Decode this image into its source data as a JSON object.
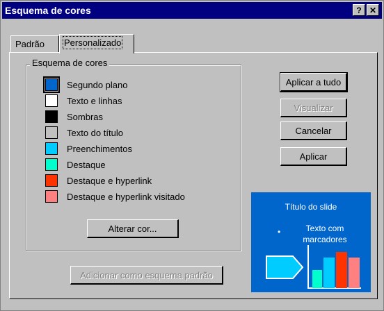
{
  "window": {
    "title": "Esquema de cores",
    "help_button": "?",
    "close_button": "✕"
  },
  "tabs": [
    {
      "label": "Padrão"
    },
    {
      "label": "Personalizado"
    }
  ],
  "group": {
    "label": "Esquema de cores",
    "items": [
      {
        "label": "Segundo plano",
        "color": "#0066cc",
        "selected": true
      },
      {
        "label": "Texto e linhas",
        "color": "#ffffff"
      },
      {
        "label": "Sombras",
        "color": "#000000"
      },
      {
        "label": "Texto do título",
        "color": "#c0c0c0"
      },
      {
        "label": "Preenchimentos",
        "color": "#00ccff"
      },
      {
        "label": "Destaque",
        "color": "#00ffcc"
      },
      {
        "label": "Destaque e hyperlink",
        "color": "#ff3300"
      },
      {
        "label": "Destaque e hyperlink visitado",
        "color": "#ff8080"
      }
    ],
    "change_color_button": "Alterar cor..."
  },
  "buttons": {
    "apply_all": "Aplicar a tudo",
    "preview": "Visualizar",
    "cancel": "Cancelar",
    "apply": "Aplicar",
    "add_standard": "Adicionar como esquema padrão"
  },
  "preview_slide": {
    "title": "Título do slide",
    "bullet": "•",
    "text_line1": "Texto com",
    "text_line2": "marcadores"
  }
}
